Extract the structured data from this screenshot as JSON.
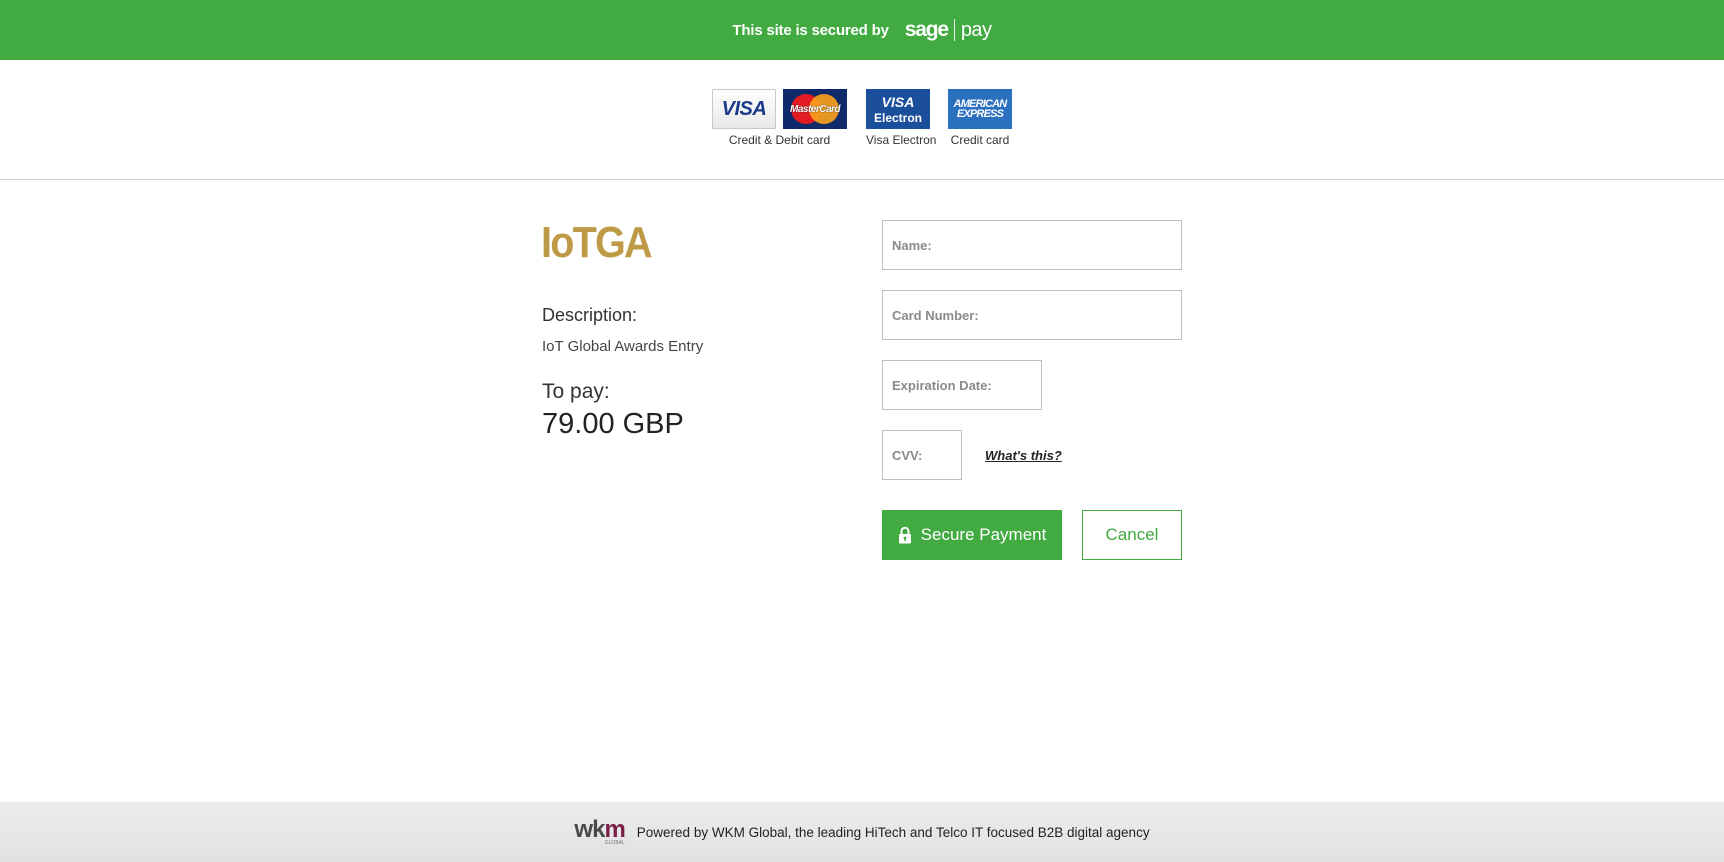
{
  "banner": {
    "secured_text": "This site is secured by",
    "brand_left": "sage",
    "brand_right": "pay",
    "color": "#41aa41"
  },
  "card_logos": {
    "groups": [
      {
        "caption": "Credit & Debit card",
        "logos": [
          {
            "icon": "visa-logo-icon",
            "text": "VISA"
          },
          {
            "icon": "mastercard-logo-icon",
            "text": "MasterCard"
          }
        ]
      },
      {
        "caption": "Visa Electron",
        "logos": [
          {
            "icon": "visa-electron-logo-icon",
            "text": "VISA",
            "sub": "Electron"
          }
        ]
      },
      {
        "caption": "Credit card",
        "logos": [
          {
            "icon": "amex-logo-icon",
            "line1": "AMERICAN",
            "line2": "EXPRESS"
          }
        ]
      }
    ]
  },
  "merchant": {
    "logo_text": "IoTGA",
    "logo_color": "#bf9a46",
    "description_label": "Description:",
    "description_value": "IoT Global Awards Entry",
    "to_pay_label": "To pay:",
    "amount": "79.00 GBP"
  },
  "form": {
    "name_placeholder": "Name:",
    "card_placeholder": "Card Number:",
    "expiry_placeholder": "Expiration Date:",
    "cvv_placeholder": "CVV:",
    "cvv_help_link": "What's this?",
    "pay_button": "Secure Payment",
    "pay_icon": "lock-icon",
    "cancel_button": "Cancel"
  },
  "footer": {
    "logo_text_w": "wk",
    "logo_text_m": "m",
    "logo_sub": "GLOBAL",
    "text": "Powered by WKM Global, the leading HiTech and Telco IT focused B2B digital agency"
  }
}
